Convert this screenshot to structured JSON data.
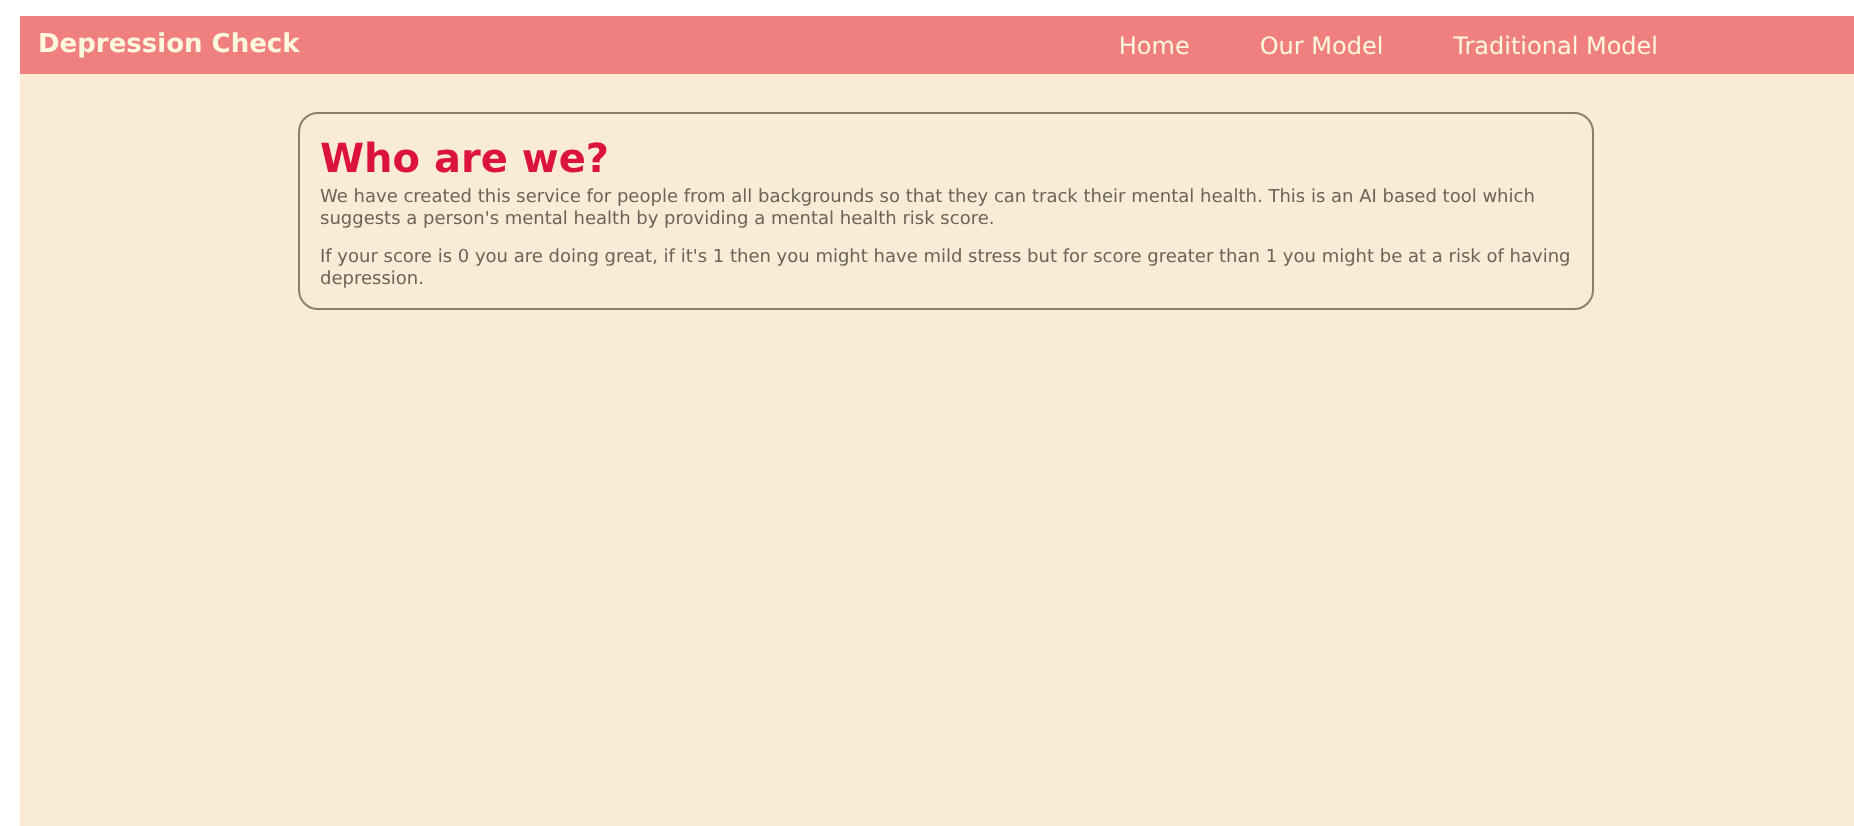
{
  "navbar": {
    "brand": "Depression Check",
    "links": [
      "Home",
      "Our Model",
      "Traditional Model"
    ]
  },
  "card": {
    "title": "Who are we?",
    "paragraphs": [
      "We have created this service for people from all backgrounds so that they can track their mental health. This is an AI based tool which suggests a person's mental health by providing a mental health risk score.",
      "If your score is 0 you are doing great, if it's 1 then you might have mild stress but for score greater than 1 you might be at a risk of having depression."
    ]
  }
}
